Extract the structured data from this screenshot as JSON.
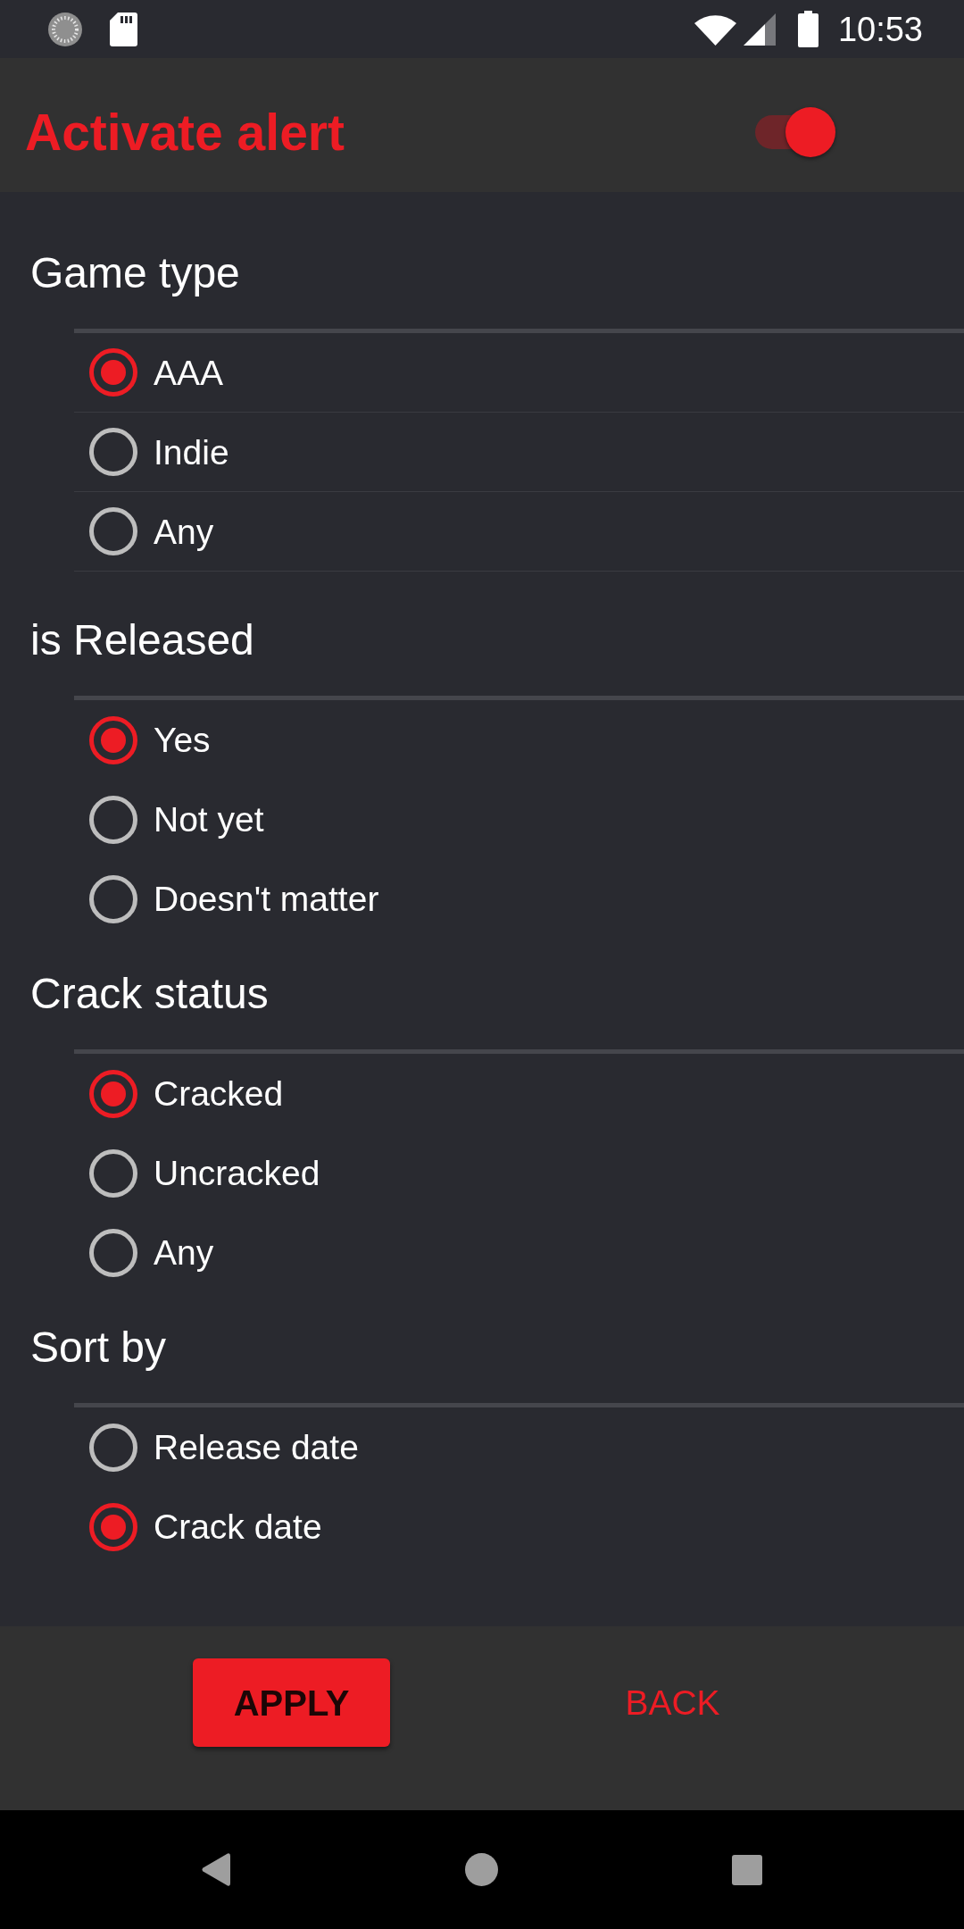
{
  "status_bar": {
    "time": "10:53"
  },
  "header": {
    "title": "Activate alert",
    "toggle": {
      "on": true
    }
  },
  "sections": [
    {
      "title": "Game type",
      "row_dividers": true,
      "options": [
        {
          "label": "AAA",
          "selected": true
        },
        {
          "label": "Indie",
          "selected": false
        },
        {
          "label": "Any",
          "selected": false
        }
      ]
    },
    {
      "title": "is Released",
      "row_dividers": false,
      "options": [
        {
          "label": "Yes",
          "selected": true
        },
        {
          "label": "Not yet",
          "selected": false
        },
        {
          "label": "Doesn't matter",
          "selected": false
        }
      ]
    },
    {
      "title": "Crack status",
      "row_dividers": false,
      "options": [
        {
          "label": "Cracked",
          "selected": true
        },
        {
          "label": "Uncracked",
          "selected": false
        },
        {
          "label": "Any",
          "selected": false
        }
      ]
    },
    {
      "title": "Sort by",
      "row_dividers": false,
      "options": [
        {
          "label": "Release date",
          "selected": false
        },
        {
          "label": "Crack date",
          "selected": true
        }
      ]
    }
  ],
  "actions": [
    {
      "label": "APPLY",
      "kind": "filled"
    },
    {
      "label": "BACK",
      "kind": "text"
    }
  ]
}
